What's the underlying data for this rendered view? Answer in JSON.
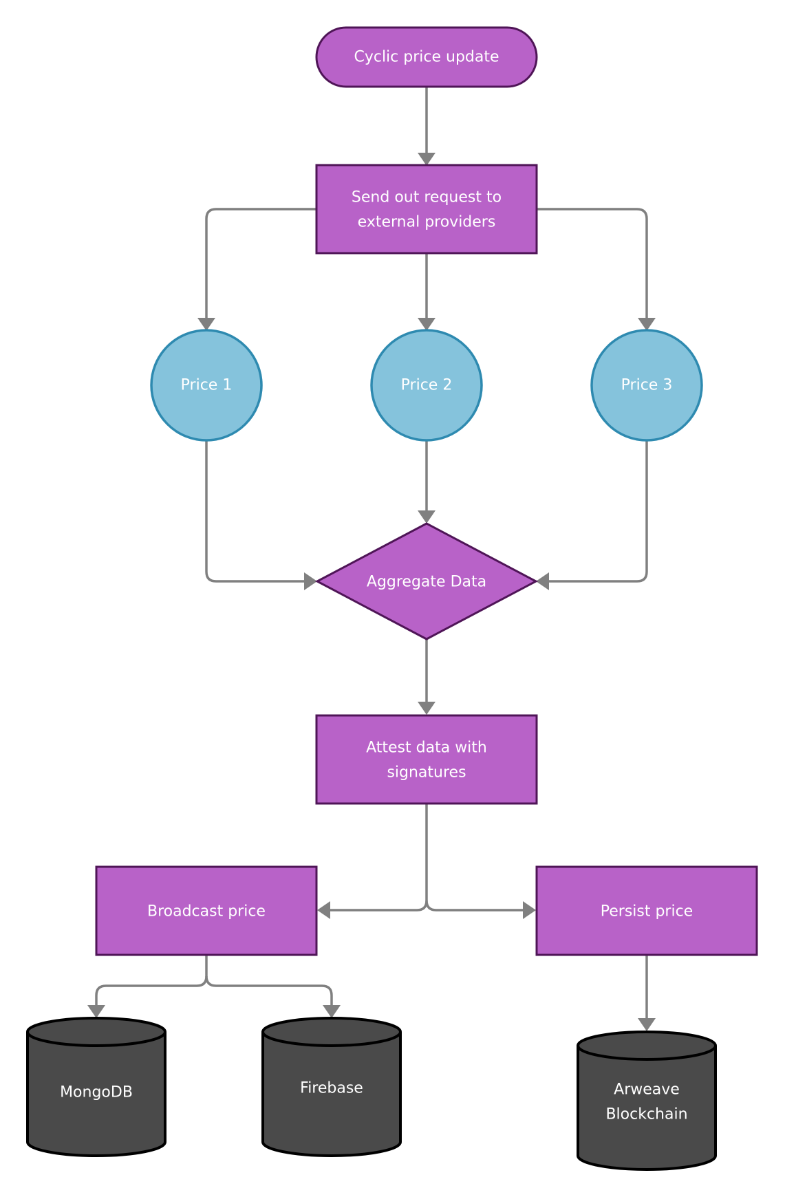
{
  "diagram": {
    "type": "flowchart",
    "colors": {
      "process_fill": "#b862c8",
      "process_stroke": "#4f1557",
      "circle_fill": "#85c3dc",
      "circle_stroke": "#2e8ab0",
      "database_fill": "#4a4a4a",
      "database_stroke": "#000000",
      "connector": "#808080",
      "label_text": "#ffffff"
    },
    "nodes": {
      "start": {
        "shape": "terminal",
        "lines": [
          "Cyclic price update"
        ]
      },
      "request": {
        "shape": "process",
        "lines": [
          "Send out request to",
          "external providers"
        ]
      },
      "price1": {
        "shape": "circle",
        "lines": [
          "Price 1"
        ]
      },
      "price2": {
        "shape": "circle",
        "lines": [
          "Price 2"
        ]
      },
      "price3": {
        "shape": "circle",
        "lines": [
          "Price 3"
        ]
      },
      "aggregate": {
        "shape": "decision",
        "lines": [
          "Aggregate Data"
        ]
      },
      "attest": {
        "shape": "process",
        "lines": [
          "Attest data with",
          "signatures"
        ]
      },
      "broadcast": {
        "shape": "process",
        "lines": [
          "Broadcast price"
        ]
      },
      "persist": {
        "shape": "process",
        "lines": [
          "Persist price"
        ]
      },
      "mongodb": {
        "shape": "database",
        "lines": [
          "MongoDB"
        ]
      },
      "firebase": {
        "shape": "database",
        "lines": [
          "Firebase"
        ]
      },
      "arweave": {
        "shape": "database",
        "lines": [
          "Arweave",
          "Blockchain"
        ]
      }
    },
    "edges": [
      {
        "from": "start",
        "to": "request"
      },
      {
        "from": "request",
        "to": "price1"
      },
      {
        "from": "request",
        "to": "price2"
      },
      {
        "from": "request",
        "to": "price3"
      },
      {
        "from": "price1",
        "to": "aggregate"
      },
      {
        "from": "price2",
        "to": "aggregate"
      },
      {
        "from": "price3",
        "to": "aggregate"
      },
      {
        "from": "aggregate",
        "to": "attest"
      },
      {
        "from": "attest",
        "to": "broadcast"
      },
      {
        "from": "attest",
        "to": "persist"
      },
      {
        "from": "broadcast",
        "to": "mongodb"
      },
      {
        "from": "broadcast",
        "to": "firebase"
      },
      {
        "from": "persist",
        "to": "arweave"
      }
    ]
  }
}
